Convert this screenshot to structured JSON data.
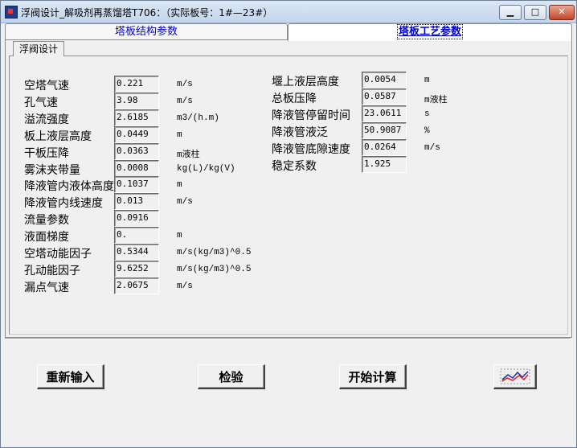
{
  "window": {
    "title": "浮阀设计_解吸剂再蒸馏塔T706：（实际板号：1#—23#）",
    "min": "▁",
    "max": "□",
    "close": "✕"
  },
  "tabs": [
    {
      "label": "塔板结构参数",
      "active": false
    },
    {
      "label": "塔板工艺参数",
      "active": true
    }
  ],
  "subtab": {
    "label": "浮阀设计"
  },
  "left_params": [
    {
      "label": "空塔气速",
      "value": "0.221",
      "unit": "m/s"
    },
    {
      "label": "孔气速",
      "value": "3.98",
      "unit": "m/s"
    },
    {
      "label": "溢流强度",
      "value": "2.6185",
      "unit": "m3/(h.m)"
    },
    {
      "label": "板上液层高度",
      "value": "0.0449",
      "unit": "m"
    },
    {
      "label": "干板压降",
      "value": "0.0363",
      "unit": "m液柱"
    },
    {
      "label": "雾沫夹带量",
      "value": "0.0008",
      "unit": "kg(L)/kg(V)"
    },
    {
      "label": "降液管内液体高度",
      "value": "0.1037",
      "unit": "m"
    },
    {
      "label": "降液管内线速度",
      "value": "0.013",
      "unit": "m/s"
    },
    {
      "label": "流量参数",
      "value": "0.0916",
      "unit": ""
    },
    {
      "label": "液面梯度",
      "value": "0.",
      "unit": "m"
    },
    {
      "label": "空塔动能因子",
      "value": "0.5344",
      "unit": "m/s(kg/m3)^0.5"
    },
    {
      "label": "孔动能因子",
      "value": "9.6252",
      "unit": "m/s(kg/m3)^0.5"
    },
    {
      "label": "漏点气速",
      "value": "2.0675",
      "unit": "m/s"
    }
  ],
  "right_params": [
    {
      "label": "堰上液层高度",
      "value": "0.0054",
      "unit": "m"
    },
    {
      "label": "总板压降",
      "value": "0.0587",
      "unit": "m液柱"
    },
    {
      "label": "降液管停留时间",
      "value": "23.0611",
      "unit": "s"
    },
    {
      "label": "降液管液泛",
      "value": "50.9087",
      "unit": "%"
    },
    {
      "label": "降液管底隙速度",
      "value": "0.0264",
      "unit": "m/s"
    },
    {
      "label": "稳定系数",
      "value": "1.925",
      "unit": ""
    }
  ],
  "buttons": {
    "reinput": "重新输入",
    "check": "检验",
    "calculate": "开始计算"
  },
  "icons": {
    "chart_button": "line-chart-icon"
  }
}
